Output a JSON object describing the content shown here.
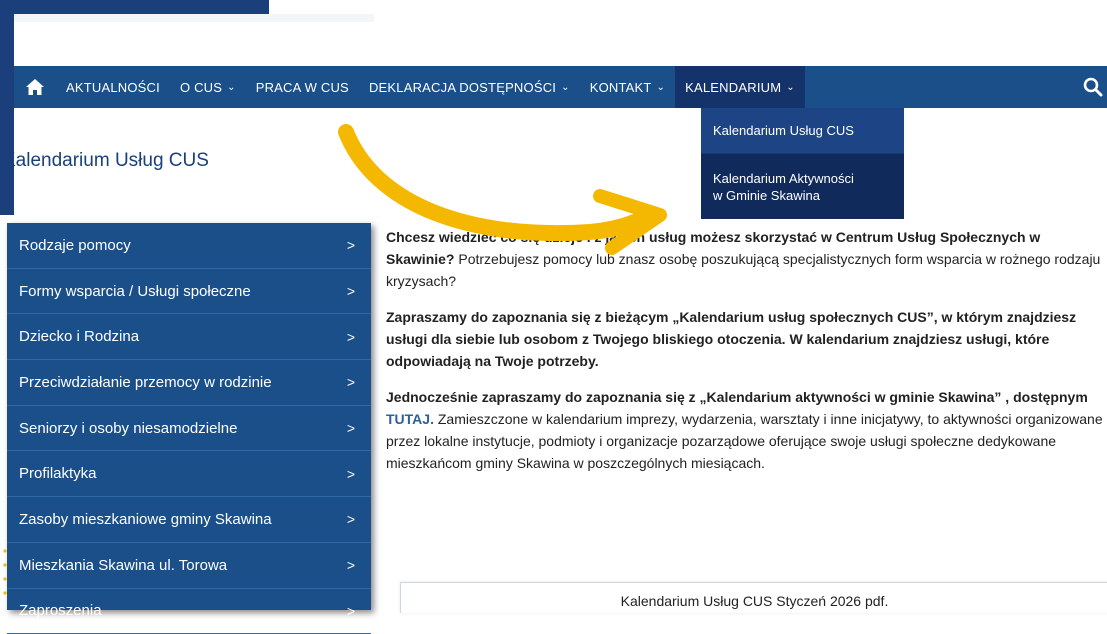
{
  "nav": {
    "items": [
      {
        "label": "AKTUALNOŚCI",
        "caret": ""
      },
      {
        "label": "O CUS",
        "caret": "⌄"
      },
      {
        "label": "PRACA W CUS",
        "caret": ""
      },
      {
        "label": "DEKLARACJA DOSTĘPNOŚCI",
        "caret": "⌄"
      },
      {
        "label": "KONTAKT",
        "caret": "⌄"
      },
      {
        "label": "KALENDARIUM",
        "caret": "⌄"
      }
    ],
    "icons": {
      "home": "home-icon",
      "search": "search-icon"
    }
  },
  "dropdown": {
    "items": [
      {
        "label": "Kalendarium Usług CUS"
      },
      {
        "label_line1": "Kalendarium Aktywności",
        "label_line2": "w Gminie Skawina"
      }
    ]
  },
  "page": {
    "title": "Kalendarium Usług CUS"
  },
  "sidebar": {
    "items": [
      {
        "label": "Rodzaje pomocy"
      },
      {
        "label": "Formy wsparcia / Usługi społeczne"
      },
      {
        "label": "Dziecko i Rodzina"
      },
      {
        "label": "Przeciwdziałanie przemocy w rodzinie"
      },
      {
        "label": "Seniorzy i osoby niesamodzielne"
      },
      {
        "label": "Profilaktyka"
      },
      {
        "label": "Zasoby mieszkaniowe gminy Skawina"
      },
      {
        "label": "Mieszkania Skawina ul. Torowa"
      },
      {
        "label": "Zaproszenia"
      }
    ],
    "chevron": ">"
  },
  "content": {
    "p1_bold": "Chcesz wiedzieć co się dzieje i z jakich usług możesz skorzystać w Centrum Usług Społecznych w Skawinie?",
    "p1_rest": " Potrzebujesz pomocy lub znasz osobę poszukującą specjalistycznych form wsparcia w rożnego rodzaju kryzysach?",
    "p2": "Zapraszamy do zapoznania się z bieżącym „Kalendarium usług społecznych CUS”,  w którym znajdziesz usługi dla siebie lub osobom z Twojego bliskiego otoczenia. W kalendarium znajdziesz usługi, które odpowiadają na Twoje potrzeby.",
    "p3_bold1": "Jednocześnie zapraszamy do zapoznania się z „Kalendarium aktywności w gminie Skawina” , dostępnym ",
    "p3_link": "TUTAJ.",
    "p3_rest": " Zamieszczone w kalendarium imprezy, wydarzenia, warsztaty i inne inicjatywy, to aktywności organizowane przez lokalne instytucje, podmioty i organizacje pozarządowe oferujące swoje usługi społeczne dedykowane mieszkańcom gminy Skawina w poszczególnych miesiącach."
  },
  "pdf": {
    "title": "Kalendarium Usług CUS Styczeń 2026 pdf."
  },
  "colors": {
    "nav": "#1a4f8a",
    "accent": "#f5b800",
    "link": "#2a5fa0"
  }
}
